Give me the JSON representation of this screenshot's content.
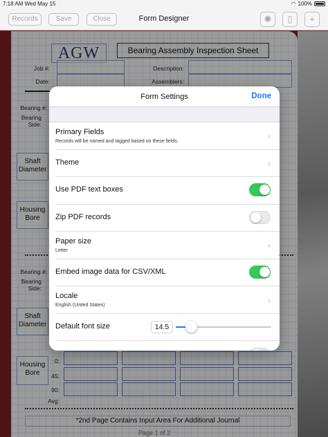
{
  "status_bar": {
    "time": "7:18 AM",
    "date": "Wed May 15",
    "battery": "100%"
  },
  "toolbar": {
    "records_label": "Records",
    "save_label": "Save",
    "close_label": "Close",
    "title": "Form Designer"
  },
  "form": {
    "logo_text": "AGW",
    "sheet_title": "Bearing Assembly Inspection Sheet",
    "job_label": "Job #:",
    "date_label": "Date:",
    "description_label": "Description:",
    "assemblers_label": "Assemblers:",
    "bearing_label": "Bearing #:",
    "bearing_side_label": "Bearing Side:",
    "shaft_diameter_label": "Shaft Diameter",
    "housing_bore_label": "Housing Bore",
    "row_labels": [
      "0:",
      "45:",
      "90:",
      "Avg:"
    ],
    "footnote": "*2nd Page Contains Input Area For Additional Journal",
    "page_label": "Page 1 of 2"
  },
  "modal": {
    "title": "Form Settings",
    "done_label": "Done",
    "rows": [
      {
        "label": "Primary Fields",
        "subtitle": "Records will be named and tagged based on these fields."
      },
      {
        "label": "Theme"
      },
      {
        "label": "Use PDF text boxes",
        "toggle": true
      },
      {
        "label": "Zip PDF records",
        "toggle": false
      },
      {
        "label": "Paper size",
        "subtitle": "Letter"
      },
      {
        "label": "Embed image data for CSV/XML",
        "toggle": true
      },
      {
        "label": "Locale",
        "subtitle": "English (United States)"
      },
      {
        "label": "Default font size",
        "value": "14.5",
        "slider_fraction": 0.16
      }
    ]
  },
  "colors": {
    "accent": "#1a7cf5",
    "toggle_on": "#34c759",
    "backdrop": "#7d1f24"
  }
}
